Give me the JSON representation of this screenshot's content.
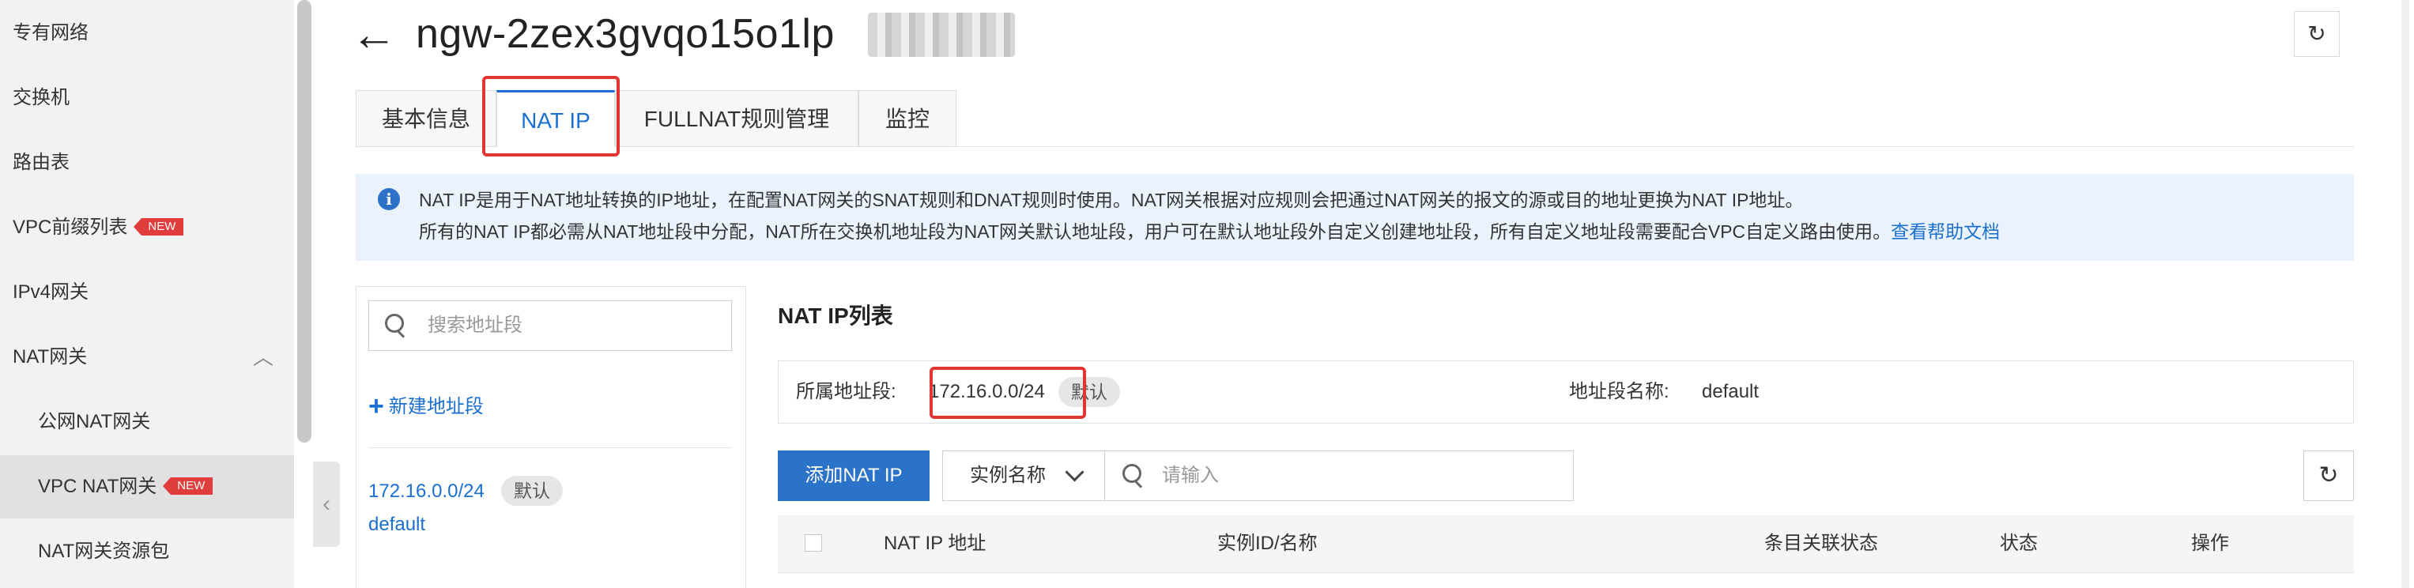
{
  "sidebar": {
    "items": [
      {
        "label": "专有网络"
      },
      {
        "label": "交换机"
      },
      {
        "label": "路由表"
      },
      {
        "label": "VPC前缀列表",
        "badge": "NEW"
      },
      {
        "label": "IPv4网关"
      },
      {
        "label": "NAT网关"
      },
      {
        "label": "公网NAT网关"
      },
      {
        "label": "VPC NAT网关",
        "badge": "NEW"
      },
      {
        "label": "NAT网关资源包"
      }
    ]
  },
  "header": {
    "title": "ngw-2zex3gvqo15o1lp"
  },
  "tabs": [
    {
      "label": "基本信息"
    },
    {
      "label": "NAT IP"
    },
    {
      "label": "FULLNAT规则管理"
    },
    {
      "label": "监控"
    }
  ],
  "info": {
    "line1": "NAT IP是用于NAT地址转换的IP地址，在配置NAT网关的SNAT规则和DNAT规则时使用。NAT网关根据对应规则会把通过NAT网关的报文的源或目的地址更换为NAT IP地址。",
    "line2": "所有的NAT IP都必需从NAT地址段中分配，NAT所在交换机地址段为NAT网关默认地址段，用户可在默认地址段外自定义创建地址段，所有自定义地址段需要配合VPC自定义路由使用。",
    "link": "查看帮助文档"
  },
  "segments": {
    "search_placeholder": "搜索地址段",
    "new_label": "新建地址段",
    "items": [
      {
        "cidr": "172.16.0.0/24",
        "tag": "默认",
        "name": "default"
      }
    ]
  },
  "main": {
    "list_title": "NAT IP列表",
    "segment_label": "所属地址段:",
    "segment_value": "172.16.0.0/24",
    "segment_tag": "默认",
    "name_label": "地址段名称:",
    "name_value": "default",
    "add_button": "添加NAT IP",
    "filter_select": "实例名称",
    "filter_placeholder": "请输入",
    "columns": [
      "NAT IP 地址",
      "实例ID/名称",
      "条目关联状态",
      "状态",
      "操作"
    ]
  }
}
